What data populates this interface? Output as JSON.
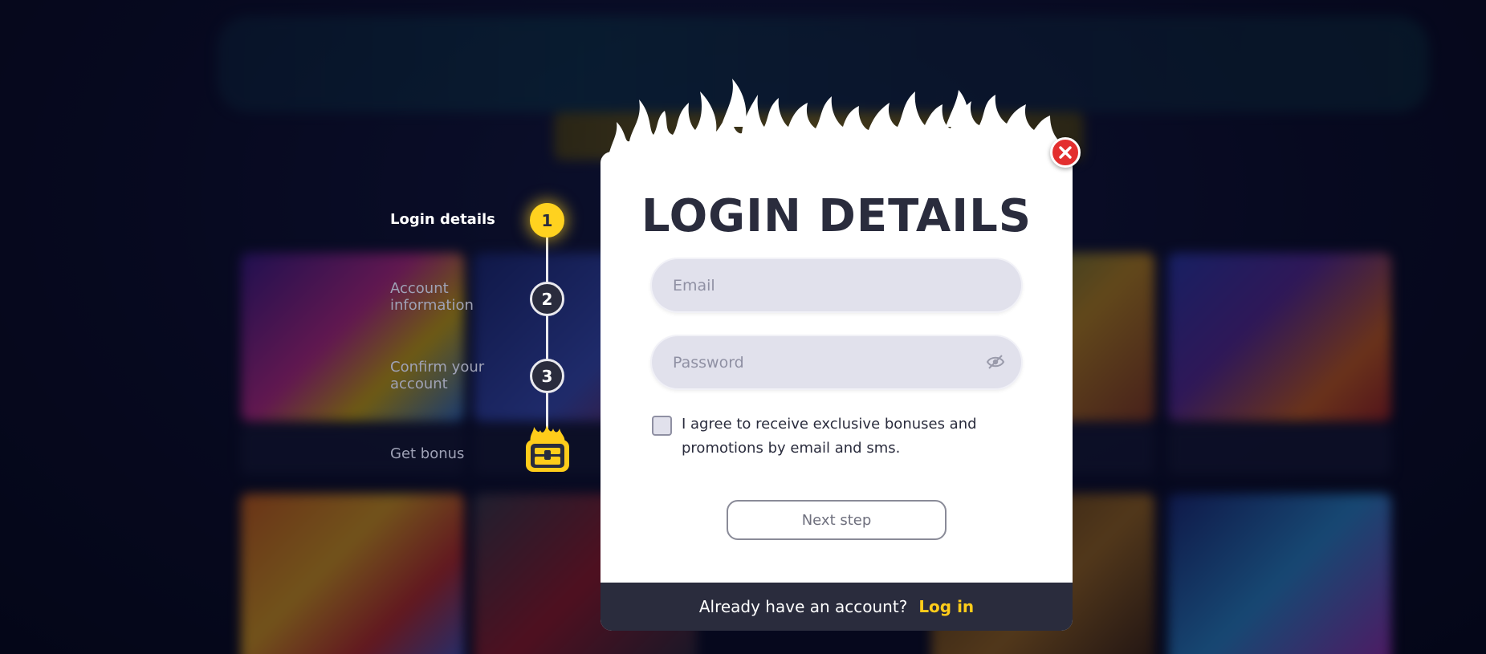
{
  "steps": [
    {
      "number": "1",
      "label": "Login details",
      "active": true
    },
    {
      "number": "2",
      "label": "Account information",
      "active": false
    },
    {
      "number": "3",
      "label": "Confirm your account",
      "active": false
    },
    {
      "number": "",
      "label": "Get bonus",
      "icon": "treasure-chest-icon",
      "active": false
    }
  ],
  "modal": {
    "title": "LOGIN DETAILS",
    "email": {
      "placeholder": "Email",
      "value": ""
    },
    "password": {
      "placeholder": "Password",
      "value": "",
      "toggle_icon": "eye-slash-icon"
    },
    "consent": {
      "checked": false,
      "text": "I agree to receive exclusive bonuses and promotions by email and sms."
    },
    "next_button": "Next step",
    "footer": {
      "text": "Already have an account?",
      "link": "Log in"
    },
    "close_icon": "close-icon"
  },
  "colors": {
    "accent": "#ffd21f",
    "link": "#ffcc1a",
    "dark": "#2a2c3d",
    "close": "#e32f2f",
    "field": "#e1e1ec"
  }
}
